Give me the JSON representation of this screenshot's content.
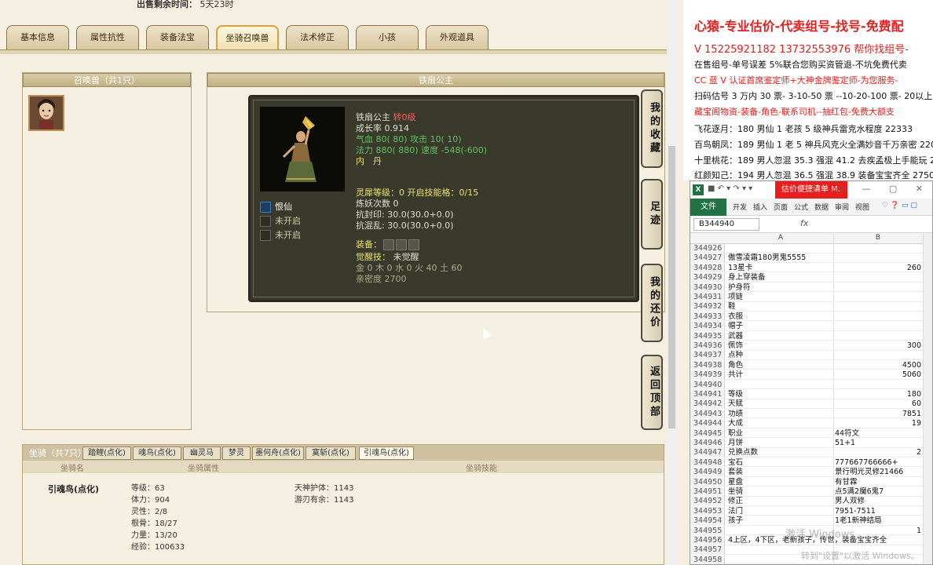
{
  "sale": {
    "label": "出售剩余时间：",
    "value": "5天23时"
  },
  "tabs": [
    "基本信息",
    "属性抗性",
    "装备法宝",
    "坐骑召唤兽",
    "法术修正",
    "小孩",
    "外观道具"
  ],
  "summon_panel": {
    "title": "召唤兽（共1只）"
  },
  "detail": {
    "title": "铁扇公主",
    "name": "铁扇公主",
    "rank": "转0级",
    "growth": "成长率 0.914",
    "hp": "气血 80( 80) 攻击 10( 10)",
    "mp_speed_a": "法力 880( 880) 速度",
    "mp_speed_b": "-548(-600)",
    "neidan": "内　丹",
    "lingxi": "灵犀等级：0 开启技能格：0/15",
    "lianyao": "炼妖次数 0",
    "resist_seal": "抗封印: 30.0(30.0+0.0)",
    "resist_chaos": "抗混乱: 30.0(30.0+0.0)",
    "equip_label": "装备：",
    "awaken_label": "觉醒技：",
    "awaken_value": "未觉醒",
    "elements": "金 0 木 0 水 0 火 40 土 60",
    "intimacy": "亲密度 2700",
    "skills": [
      "恨仙",
      "未开启",
      "未开启"
    ]
  },
  "side_buttons": [
    "我的收藏",
    "足迹",
    "我的还价",
    "返回顶部"
  ],
  "mounts": {
    "title": "坐骑（共7只）",
    "tabs": [
      "踏鲤(点化)",
      "魂鸟(点化)",
      "幽灵马",
      "梦灵",
      "墨何舟(点化)",
      "寞斩(点化)",
      "引魂鸟(点化)"
    ],
    "columns": [
      "坐骑名",
      "坐骑属性",
      "坐骑技能"
    ],
    "name": "引魂鸟(点化)",
    "attrs": [
      "等级：63",
      "体力：904",
      "灵性：2/8",
      "根骨：18/27",
      "力量：13/20",
      "经验：100633"
    ],
    "skills": [
      "天神护体：1143",
      "游刃有余：1143"
    ]
  },
  "ad": {
    "headline": "心猿-专业估价-代卖组号-找号-免费配",
    "line2": "V 15225921182  13732553976 帮你找组号-",
    "line3": "在售组号-单号误差 5%联合您购买资管退-不坑免费代卖",
    "line4": "CC 蓝 V 认证首席鉴定师+大神金牌鉴定师-为您服务-",
    "line5": "扫码估号 3 万内 30 票- 3-10-50 票 --10-20-100 票- 20以上 150",
    "line6": "藏宝阁物资-装备-角色-联系司机--抽红包-免费大额支",
    "line7": "飞花逐月：180 男仙 1 老孩 5 级神兵雷克水程度 22333",
    "line8": "百鸟朝凤：189 男仙 1 老 5 神兵风克火全满妙音千万亲密 220",
    "line9": "十里桃花：189 男人忽混 35.3 强混 41.2 去疾孟极上手能玩 2",
    "line10": "红颜知己：194 男人忽混 36.5 强混 38.9 装备宝宝齐全 27500"
  },
  "excel": {
    "doc_title": "估价便捷清单 M.",
    "file_tab": "文件",
    "ribbon_tabs": [
      "开发",
      "插入",
      "页面",
      "公式",
      "数据",
      "审阅",
      "视图"
    ],
    "namebox": "B344940",
    "fx": "fx",
    "col_a": "A",
    "col_b": "B",
    "rows": [
      {
        "n": "344926",
        "a": "",
        "b": ""
      },
      {
        "n": "344927",
        "a": "傲雪凌霜180男鬼5555",
        "b": ""
      },
      {
        "n": "344928",
        "a": "13星卡",
        "b": "260"
      },
      {
        "n": "344929",
        "a": "身上穿装备",
        "b": ""
      },
      {
        "n": "344930",
        "a": "护身符",
        "b": ""
      },
      {
        "n": "344931",
        "a": "项链",
        "b": ""
      },
      {
        "n": "344932",
        "a": "鞋",
        "b": ""
      },
      {
        "n": "344933",
        "a": "衣服",
        "b": ""
      },
      {
        "n": "344934",
        "a": "帽子",
        "b": ""
      },
      {
        "n": "344935",
        "a": "武器",
        "b": ""
      },
      {
        "n": "344936",
        "a": "佩饰",
        "b": "300"
      },
      {
        "n": "344937",
        "a": "点种",
        "b": ""
      },
      {
        "n": "344938",
        "a": "角色",
        "b": "4500"
      },
      {
        "n": "344939",
        "a": "共计",
        "b": "5060"
      },
      {
        "n": "344940",
        "a": "",
        "b": ""
      },
      {
        "n": "344941",
        "a": "等级",
        "b": "180"
      },
      {
        "n": "344942",
        "a": "天赋",
        "b": "60"
      },
      {
        "n": "344943",
        "a": "功绩",
        "b": "7851"
      },
      {
        "n": "344944",
        "a": "大成",
        "b": "19"
      },
      {
        "n": "344945",
        "a": "职业",
        "b": "44符文"
      },
      {
        "n": "344946",
        "a": "月饼",
        "b": "51+1"
      },
      {
        "n": "344947",
        "a": "兑换点数",
        "b": "2"
      },
      {
        "n": "344948",
        "a": "宝石",
        "b": "777667766666+"
      },
      {
        "n": "344949",
        "a": "套装",
        "b": "景行明光灵修21466"
      },
      {
        "n": "344950",
        "a": "星盘",
        "b": "有甘霖"
      },
      {
        "n": "344951",
        "a": "坐骑",
        "b": "点5满2魔6鬼7"
      },
      {
        "n": "344952",
        "a": "修正",
        "b": "男人双修"
      },
      {
        "n": "344953",
        "a": "法门",
        "b": "7951-7511"
      },
      {
        "n": "344954",
        "a": "孩子",
        "b": "1老1新神结局"
      },
      {
        "n": "344955",
        "a": "",
        "b": "1"
      },
      {
        "n": "344956",
        "a": "4上区，4下区，老新孩子，传世，装备宝宝齐全",
        "b": ""
      },
      {
        "n": "344957",
        "a": "",
        "b": ""
      },
      {
        "n": "344958",
        "a": "",
        "b": ""
      }
    ]
  },
  "watermark": {
    "line1": "激活 Windows",
    "line2": "转到\"设置\"以激活 Windows。"
  }
}
